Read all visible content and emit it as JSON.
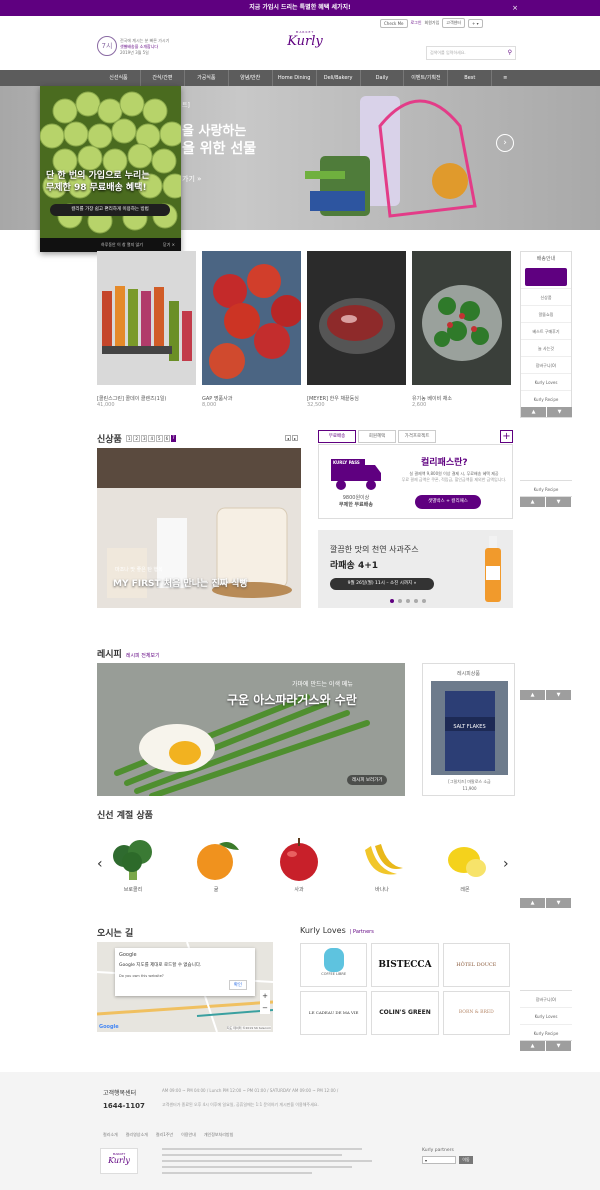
{
  "topbar": {
    "text": "지금 가입시 드리는 특별한 혜택 세가지!",
    "close": "×"
  },
  "header": {
    "check_label": "Check Me",
    "util_links": [
      "로그인",
      "회원가입",
      "고객센터"
    ],
    "promo_line1": "전국에 계시는 분 빠른 가시기",
    "promo_line2": "샛별배송을 소개합니다",
    "promo_date": "2019년 3월 5일",
    "logo_small": "MARKET",
    "logo": "Kurly",
    "search_placeholder": "검색어를 입력하세요."
  },
  "nav": [
    "신선식품",
    "간식/간편",
    "가공식품",
    "양념/반찬",
    "Home Dining",
    "Deli/Bakery",
    "Daily",
    "이벤트/기획전",
    "Best"
  ],
  "hero": {
    "line1": "을 사랑하는",
    "line2": "을 위한 선물",
    "more": "가기 »",
    "tag": "트]"
  },
  "popup": {
    "line1": "단 한 번의 가입으로 누리는",
    "line2": "무제한 98 무료배송 혜택!",
    "cta": "컬리를 가장 쉽고 편리하게 이용하는 방법",
    "no_show": "하루동안 이 창 열지 않기",
    "close": "닫기 ×"
  },
  "products": [
    {
      "name": "[콜린스그린] 콜데이 클렌즈(1일)",
      "price": "41,000"
    },
    {
      "name": "GAP 명품사과",
      "price": "8,000"
    },
    {
      "name": "[MEYER] 한우 채끝등심",
      "price": "32,500"
    },
    {
      "name": "유기농 베이비 채소",
      "price": "2,600"
    }
  ],
  "side1": {
    "title": "배송안내",
    "items": [
      "신상품",
      "알뜰쇼핑",
      "베스트 구매후기",
      "늘 사는것",
      "장바구니(0)",
      "Kurly Loves",
      "Kurly Recipe"
    ],
    "up": "▲",
    "down": "▼"
  },
  "new_section": {
    "title": "신상품",
    "pages": [
      "1",
      "2",
      "3",
      "4",
      "5",
      "6",
      "7"
    ],
    "caption_small": "마조나 맛 좋은 탄 행복",
    "caption": "MY FIRST 처음 만나는 진짜 식빵"
  },
  "tabs": [
    "무료배송",
    "회원혜택",
    "가격프로젝트"
  ],
  "pass": {
    "badge": "KURLY PASS",
    "truck_line1": "9800원이상",
    "truck_line2": "무제한 무료배송",
    "title": "컬리패스란?",
    "desc1": "실 결제액 9,800원 이상 결제 시, 무료배송 혜택 제공",
    "desc2": "무료 결제 금액은 쿠폰, 적립금, 할인금액을 제외한 금액입니다.",
    "btn": "샛별박스 + 컬리패스"
  },
  "juice": {
    "line1": "깔끔한 맛의 천연 사과주스",
    "line2": "라패송 4+1",
    "date": "9월 26일(월) 11시 – 소진 시까지 »"
  },
  "side2": {
    "items": [
      "Kurly Recipe"
    ],
    "up": "▲",
    "down": "▼"
  },
  "recipe": {
    "title": "레시피",
    "link": "레시피 전체보기",
    "sub": "가마에 만드는 이색 메뉴",
    "main": "구운 아스파라거스와 수란",
    "more": "레시피 보러가기"
  },
  "recipe_product": {
    "title": "레시피상품",
    "brand": "SALT FLAKES",
    "name": "[그릴치즈] 마말로스 소금",
    "price": "11,900"
  },
  "season": {
    "title": "신선 계절 상품",
    "items": [
      "브로콜리",
      "귤",
      "사과",
      "바나나",
      "레몬"
    ],
    "prev": "‹",
    "next": "›"
  },
  "map": {
    "title": "오시는 길",
    "google": "Google",
    "msg": "Google 지도를 제대로 로드할 수 없습니다.",
    "ask": "Do you own this website?",
    "ok": "확인",
    "copyright": "지도 데이터 ©2019 SK telecom"
  },
  "loves": {
    "title": "Kurly Loves",
    "partners": "| Partners",
    "brands": [
      "COFFEE LIBRE",
      "BISTECCA",
      "HÔTEL DOUCE",
      "LE CADEAU DE MA VIE",
      "COLIN'S GREEN",
      "BORN & BRED"
    ]
  },
  "side3": {
    "items": [
      "장바구니(0)",
      "Kurly Loves",
      "Kurly Recipe"
    ],
    "up": "▲",
    "down": "▼"
  },
  "footer": {
    "cs_title": "고객행복센터",
    "phone": "1644-1107",
    "hours": "AM 09:00 ~ PM 04:00 / Lunch PM 12:00 ~ PM 01:00 / SATURDAY AM 09:00 ~ PM 12:00 /",
    "hours2": "고객센터가 종료된 오후 4시 이후에 일요일, 공휴일에는 1:1 문의하기 게시판을 이용해주세요.",
    "links": [
      "컬리소개",
      "컬리영상소개",
      "컬리1주년",
      "이용안내",
      "개인정보처리방침"
    ],
    "partners_label": "Kurly partners",
    "partners_btn": "이동"
  },
  "colors": {
    "brand": "#5f0080",
    "nav": "#5c5c5c"
  }
}
